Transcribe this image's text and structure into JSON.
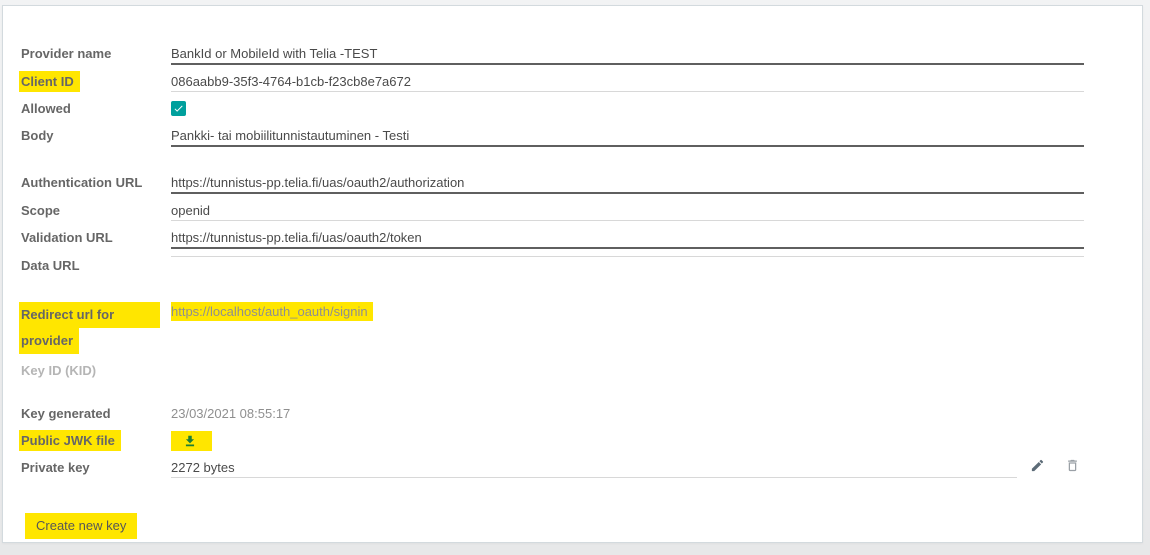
{
  "form": {
    "provider_name": {
      "label": "Provider name",
      "value": "BankId or MobileId with Telia -TEST"
    },
    "client_id": {
      "label": "Client ID",
      "value": "086aabb9-35f3-4764-b1cb-f23cb8e7a672"
    },
    "allowed": {
      "label": "Allowed",
      "checked": true
    },
    "body": {
      "label": "Body",
      "value": "Pankki- tai mobiilitunnistautuminen - Testi"
    },
    "auth_url": {
      "label": "Authentication URL",
      "value": "https://tunnistus-pp.telia.fi/uas/oauth2/authorization"
    },
    "scope": {
      "label": "Scope",
      "value": "openid"
    },
    "validation_url": {
      "label": "Validation URL",
      "value": "https://tunnistus-pp.telia.fi/uas/oauth2/token"
    },
    "data_url": {
      "label": "Data URL",
      "value": ""
    },
    "redirect_url": {
      "label_line1": "Redirect url for",
      "label_line2": "provider",
      "value": "https://localhost/auth_oauth/signin"
    },
    "key_id": {
      "label": "Key ID (KID)",
      "value": ""
    },
    "key_generated": {
      "label": "Key generated",
      "value": "23/03/2021 08:55:17"
    },
    "public_jwk": {
      "label": "Public JWK file"
    },
    "private_key": {
      "label": "Private key",
      "value": "2272 bytes"
    },
    "create_key_button": "Create new key"
  },
  "colors": {
    "highlight": "#ffe600",
    "checkbox": "#00a09d",
    "download_icon": "#1e7e34",
    "required_underline": "#5f5f5f",
    "underline": "#d8d8d8"
  }
}
